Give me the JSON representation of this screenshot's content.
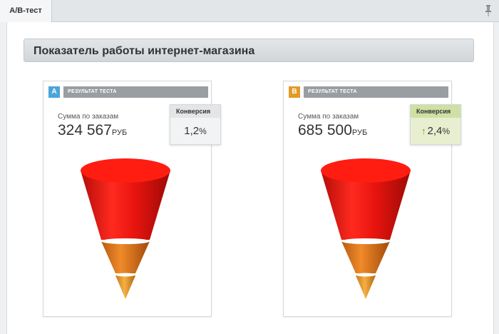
{
  "tab": {
    "label": "А/В-тест"
  },
  "header": {
    "title": "Показатель работы интернет-магазина"
  },
  "colors": {
    "a_badge": "#4aa5d9",
    "b_badge": "#e39b27",
    "funnel_top": "#e8140f",
    "funnel_bottom": "#e07c1d",
    "conversion_up": "#6f9a2a"
  },
  "icons": {
    "pin": "pin-icon",
    "arrow": "arrow-up-icon"
  },
  "cards": [
    {
      "badge": "A",
      "title": "РЕЗУЛЬТАТ ТЕСТА",
      "sum_label": "Сумма по заказам",
      "sum_value": "324 567",
      "currency": "РУБ",
      "conversion_label": "Конверсия",
      "conversion_value": "1,2",
      "conversion_unit": "%"
    },
    {
      "badge": "B",
      "title": "РЕЗУЛЬТАТ ТЕСТА",
      "sum_label": "Сумма по заказам",
      "sum_value": "685 500",
      "currency": "РУБ",
      "conversion_label": "Конверсия",
      "conversion_arrow": "↑",
      "conversion_value": "2,4",
      "conversion_unit": "%"
    }
  ]
}
